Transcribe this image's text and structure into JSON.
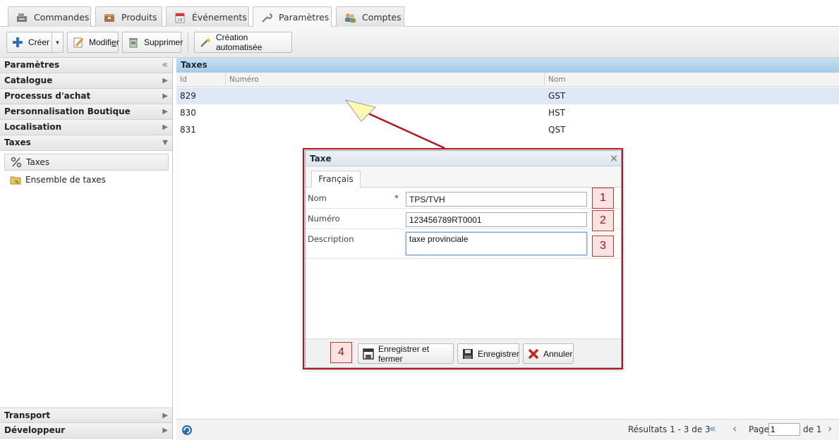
{
  "tabs": [
    {
      "label": "Commandes",
      "icon": "cash-register-icon"
    },
    {
      "label": "Produits",
      "icon": "box-icon"
    },
    {
      "label": "Événements",
      "icon": "calendar-icon"
    },
    {
      "label": "Paramètres",
      "icon": "wrench-icon"
    },
    {
      "label": "Comptes",
      "icon": "users-icon"
    }
  ],
  "toolbar": {
    "create": "Créer",
    "edit_prefix": "Modifi",
    "edit_underlined": "e",
    "edit_suffix": "r",
    "delete": "Supprimer",
    "auto": "Création automatisée"
  },
  "sidebar": {
    "sections": [
      {
        "label": "Paramètres",
        "arrow": "«"
      },
      {
        "label": "Catalogue",
        "arrow": "▶"
      },
      {
        "label": "Processus d'achat",
        "arrow": "▶"
      },
      {
        "label": "Personnalisation Boutique",
        "arrow": "▶"
      },
      {
        "label": "Localisation",
        "arrow": "▶"
      },
      {
        "label": "Taxes",
        "arrow": "▼"
      }
    ],
    "items": [
      {
        "label": "Taxes",
        "icon": "percent-icon"
      },
      {
        "label": "Ensemble de taxes",
        "icon": "folder-tax-icon"
      }
    ],
    "bottom_sections": [
      {
        "label": "Transport",
        "arrow": "▶"
      },
      {
        "label": "Développeur",
        "arrow": "▶"
      }
    ]
  },
  "grid": {
    "title": "Taxes",
    "columns": [
      "Id",
      "Numéro",
      "Nom"
    ],
    "rows": [
      {
        "id": "829",
        "numero": "",
        "nom": "GST"
      },
      {
        "id": "830",
        "numero": "",
        "nom": "HST"
      },
      {
        "id": "831",
        "numero": "",
        "nom": "QST"
      }
    ],
    "footer": {
      "results": "Résultats 1 - 3 de 3",
      "page_label": "Page",
      "page_value": "1",
      "of_label": "de 1"
    }
  },
  "modal": {
    "title": "Taxe",
    "close": "×",
    "tab": "Français",
    "fields": {
      "nom_label": "Nom",
      "required_mark": "*",
      "nom_value": "TPS/TVH",
      "numero_label": "Numéro",
      "numero_value": "123456789RT0001",
      "description_label": "Description",
      "description_value": "taxe provinciale"
    },
    "markers": [
      "1",
      "2",
      "3",
      "4"
    ],
    "buttons": {
      "save_close": "Enregistrer et fermer",
      "save": "Enregistrer",
      "cancel": "Annuler"
    }
  },
  "colors": {
    "annotation_red": "#b5151b",
    "grid_header_blue": "#a8cbe5",
    "selected_row": "#dfe8f6"
  }
}
